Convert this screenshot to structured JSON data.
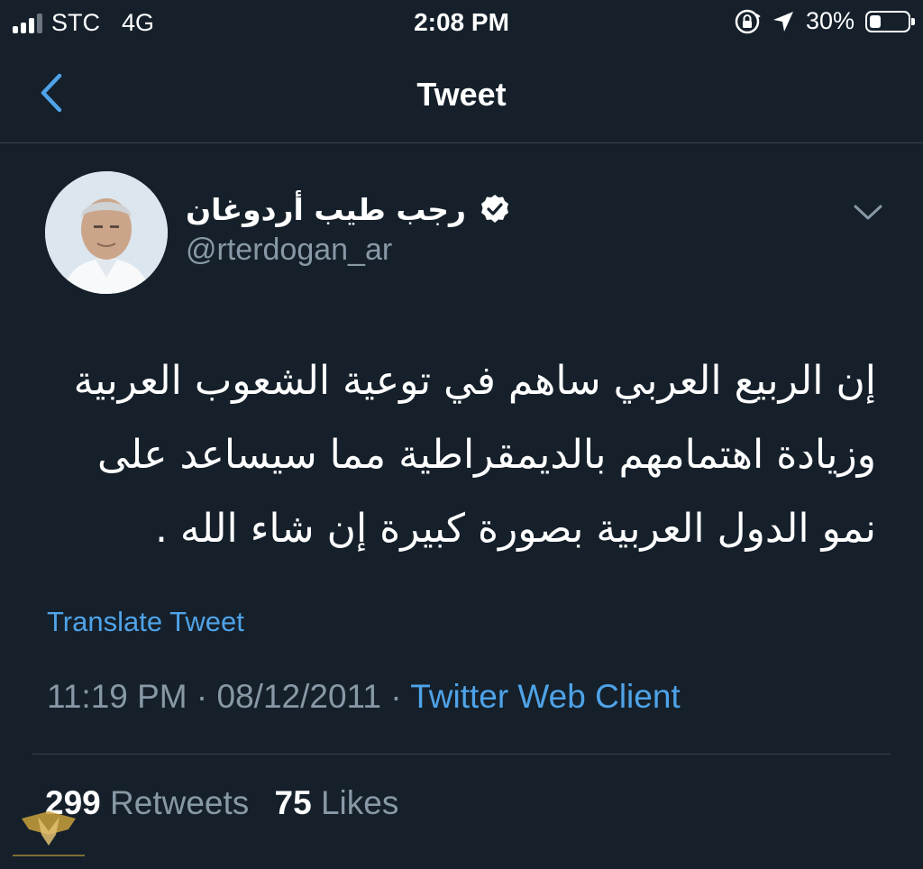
{
  "status_bar": {
    "carrier": "STC",
    "network": "4G",
    "time": "2:08 PM",
    "battery": "30%",
    "battery_level": 0.3
  },
  "nav": {
    "title": "Tweet",
    "back_icon": "chevron-left-icon"
  },
  "tweet": {
    "display_name": "رجب طيب أردوغان",
    "handle": "@rterdogan_ar",
    "verified": true,
    "lines": [
      "إن الربيع العربي ساهم في توعية الشعوب العربية",
      "وزيادة اهتمامهم بالديمقراطية مما سيساعد على",
      "نمو الدول العربية بصورة كبيرة إن شاء الله ."
    ],
    "translate_label": "Translate Tweet",
    "time": "11:19 PM",
    "date": "08/12/2011",
    "separator": "·",
    "client": "Twitter Web Client",
    "retweets_count": "299",
    "retweets_label": "Retweets",
    "likes_count": "75",
    "likes_label": "Likes"
  },
  "colors": {
    "background": "#15202b",
    "accent": "#4fa3e8",
    "secondary_text": "#8899a6",
    "divider": "#38444d"
  }
}
